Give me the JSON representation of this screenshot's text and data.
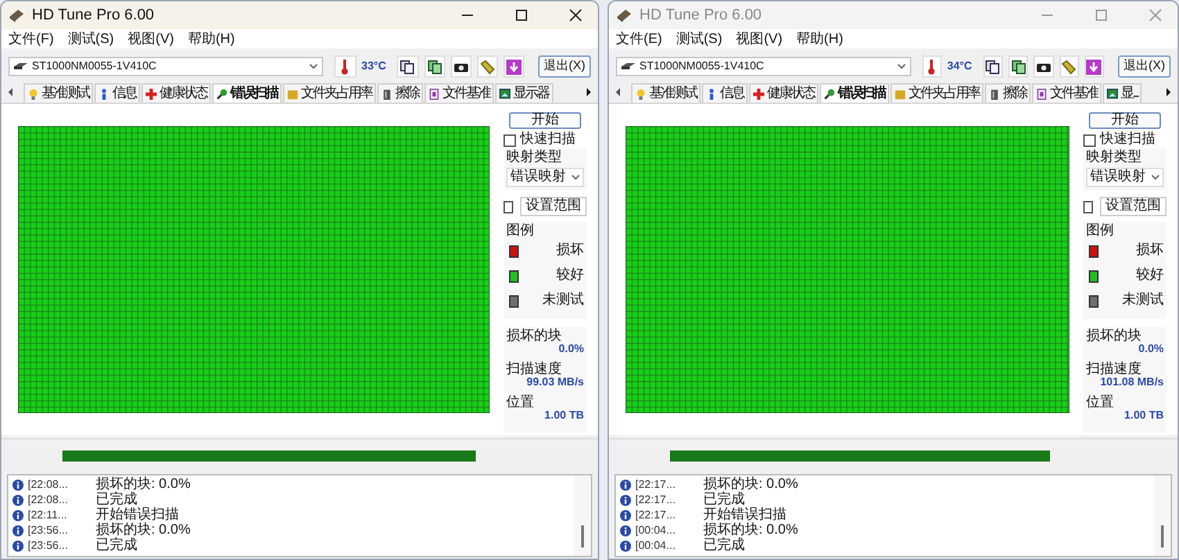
{
  "windows": [
    {
      "title": "HD Tune Pro 6.00",
      "active": true,
      "menu": [
        "文件(F)",
        "测试(S)",
        "视图(V)",
        "帮助(H)"
      ],
      "drive": "ST1000NM0055-1V410C",
      "temperature": "33°C",
      "exit_button": "退出(X)",
      "tabs": [
        {
          "label": "基准测试",
          "selected": false
        },
        {
          "label": "信息",
          "selected": false
        },
        {
          "label": "健康状态",
          "selected": false
        },
        {
          "label": "错误扫描",
          "selected": true
        },
        {
          "label": "文件夹占用率",
          "selected": false
        },
        {
          "label": "擦除",
          "selected": false
        },
        {
          "label": "文件基准",
          "selected": false
        },
        {
          "label": "显示器",
          "selected": false
        }
      ],
      "start_button": "开始",
      "quick_scan": {
        "label": "快速扫描",
        "checked": false
      },
      "map_type_label": "映射类型",
      "map_type": "错误映射",
      "set_range": {
        "label": "设置范围",
        "checked": false
      },
      "legend_title": "图例",
      "legend": [
        {
          "label": "损坏",
          "color": "#d01010"
        },
        {
          "label": "较好",
          "color": "#20c020"
        },
        {
          "label": "未测试",
          "color": "#707070"
        }
      ],
      "stats": [
        {
          "label": "损坏的块",
          "value": "0.0%"
        },
        {
          "label": "扫描速度",
          "value": "99.03 MB/s"
        },
        {
          "label": "位置",
          "value": "1.00 TB"
        }
      ],
      "progress": {
        "level": 0.87
      },
      "log": [
        {
          "time": "[22:08...",
          "message": "损坏的块: 0.0%"
        },
        {
          "time": "[22:08...",
          "message": "已完成"
        },
        {
          "time": "[22:11...",
          "message": "开始错误扫描"
        },
        {
          "time": "[23:56...",
          "message": "损坏的块: 0.0%"
        },
        {
          "time": "[23:56...",
          "message": "已完成"
        }
      ]
    },
    {
      "title": "HD Tune Pro 6.00",
      "active": false,
      "menu": [
        "文件(E)",
        "测试(S)",
        "视图(V)",
        "帮助(H)"
      ],
      "drive": "ST1000NM0055-1V410C",
      "temperature": "34°C",
      "exit_button": "退出(X)",
      "tabs": [
        {
          "label": "基准测试",
          "selected": false
        },
        {
          "label": "信息",
          "selected": false
        },
        {
          "label": "健康状态",
          "selected": false
        },
        {
          "label": "错误扫描",
          "selected": true
        },
        {
          "label": "文件夹占用率",
          "selected": false
        },
        {
          "label": "擦除",
          "selected": false
        },
        {
          "label": "文件基准",
          "selected": false
        },
        {
          "label": "显...",
          "selected": false
        }
      ],
      "start_button": "开始",
      "quick_scan": {
        "label": "快速扫描",
        "checked": false
      },
      "map_type_label": "映射类型",
      "map_type": "错误映射",
      "set_range": {
        "label": "设置范围",
        "checked": false
      },
      "legend_title": "图例",
      "legend": [
        {
          "label": "损坏",
          "color": "#d01010"
        },
        {
          "label": "较好",
          "color": "#20c020"
        },
        {
          "label": "未测试",
          "color": "#707070"
        }
      ],
      "stats": [
        {
          "label": "损坏的块",
          "value": "0.0%"
        },
        {
          "label": "扫描速度",
          "value": "101.08 MB/s"
        },
        {
          "label": "位置",
          "value": "1.00 TB"
        }
      ],
      "progress": {
        "level": 0.85
      },
      "log": [
        {
          "time": "[22:17...",
          "message": "损坏的块: 0.0%"
        },
        {
          "time": "[22:17...",
          "message": "已完成"
        },
        {
          "time": "[22:17...",
          "message": "开始错误扫描"
        },
        {
          "time": "[00:04...",
          "message": "损坏的块: 0.0%"
        },
        {
          "time": "[00:04...",
          "message": "已完成"
        }
      ]
    }
  ]
}
